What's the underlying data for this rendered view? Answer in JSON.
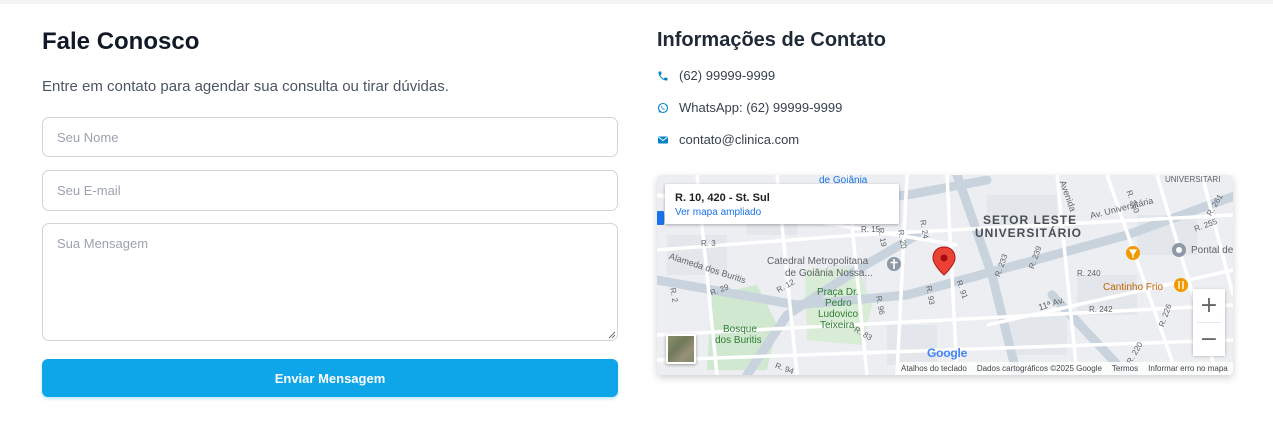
{
  "form": {
    "title": "Fale Conosco",
    "subtitle": "Entre em contato para agendar sua consulta ou tirar dúvidas.",
    "name_placeholder": "Seu Nome",
    "email_placeholder": "Seu E-mail",
    "message_placeholder": "Sua Mensagem",
    "submit_label": "Enviar Mensagem"
  },
  "contact": {
    "title": "Informações de Contato",
    "phone": "(62) 99999-9999",
    "whatsapp": "WhatsApp: (62) 99999-9999",
    "email": "contato@clinica.com"
  },
  "map": {
    "place_address": "R. 10, 420 - St. Sul",
    "place_link": "Ver mapa ampliado",
    "zoom_in": "+",
    "zoom_out": "−",
    "google_logo": "Google",
    "attribution": {
      "shortcuts": "Atalhos do teclado",
      "data": "Dados cartográficos ©2025 Google",
      "terms": "Termos",
      "report": "Informar erro no mapa"
    },
    "labels": {
      "setor_leste_line1": "SETOR LESTE",
      "setor_leste_line2": "UNIVERSITÁRIO",
      "catedral_line1": "Catedral Metropolitana",
      "catedral_line2": "de Goiânia Nossa...",
      "praca_line1": "Praça Dr.",
      "praca_line2": "Pedro",
      "praca_line3": "Ludovico",
      "praca_line4": "Teixeira",
      "bosque_line1": "Bosque",
      "bosque_line2": "dos Buritis",
      "alameda": "Alameda dos Buritis",
      "cantinho": "Cantinho Frio",
      "pontal": "Pontal de",
      "av_universitaria": "Av. Universitária",
      "universitari": "UNIVERSITARI",
      "de_goiania": "de Goiânia",
      "avenida": "Avenida",
      "av_11": "11ª Av.",
      "r3": "R. 3",
      "r2": "R. 2",
      "r29": "R. 29",
      "r12": "R. 12",
      "r24": "R. 24",
      "r20": "R. 20",
      "r19": "R. 19",
      "r15": "R. 15",
      "r93": "R. 93",
      "r91": "R. 91",
      "r233": "R. 233",
      "r239": "R. 239",
      "r240": "R. 240",
      "r242": "R. 242",
      "r226": "R. 226",
      "r220": "R. 220",
      "r255": "R. 255",
      "r261": "R. 261",
      "r260": "R. 260",
      "r96": "R. 96",
      "r83": "R. 83",
      "r94": "R. 94"
    }
  },
  "colors": {
    "primary_button": "#0ea5e9",
    "title_text": "#111827",
    "icon_blue": "#0284c7",
    "map_marker": "#ea4335",
    "park_green": "#c8e6c9"
  }
}
